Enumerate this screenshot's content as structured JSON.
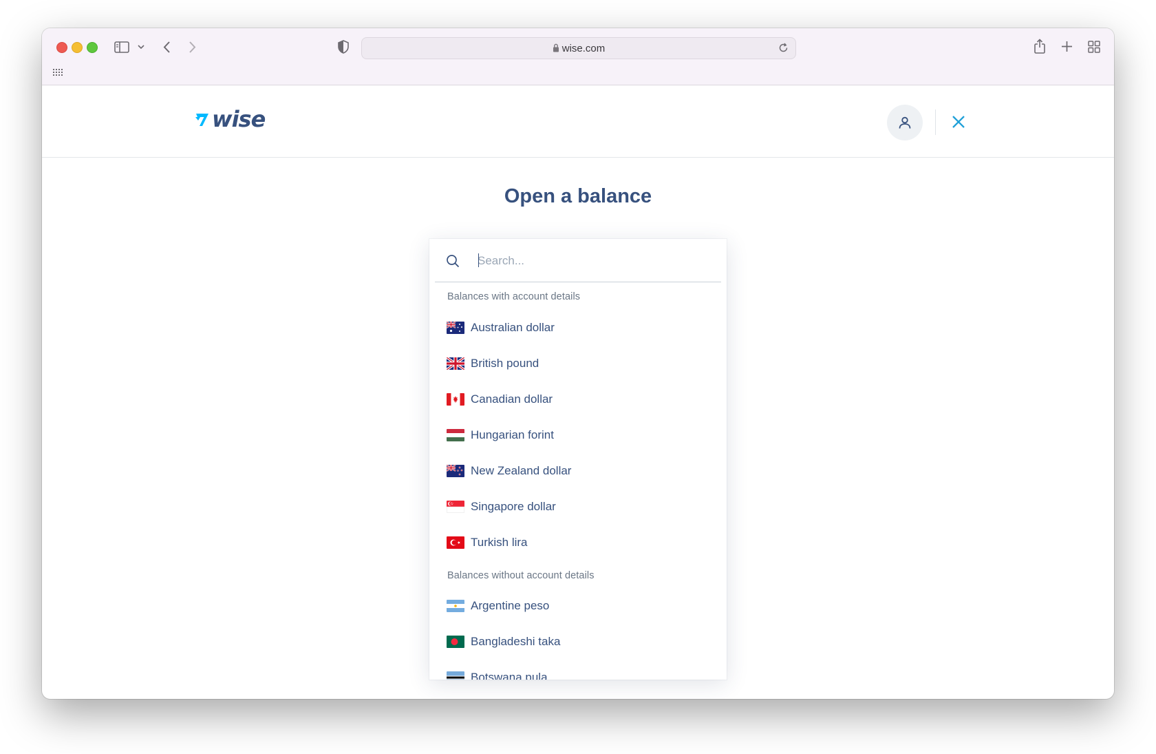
{
  "browser": {
    "url": "wise.com"
  },
  "header": {
    "logo_text": "WISE"
  },
  "page": {
    "title": "Open a balance"
  },
  "search": {
    "placeholder": "Search..."
  },
  "groups": [
    {
      "label": "Balances with account details",
      "items": [
        {
          "label": "Australian dollar",
          "flag": "au-flag"
        },
        {
          "label": "British pound",
          "flag": "gb-flag"
        },
        {
          "label": "Canadian dollar",
          "flag": "ca-flag"
        },
        {
          "label": "Hungarian forint",
          "flag": "hu-flag"
        },
        {
          "label": "New Zealand dollar",
          "flag": "nz-flag"
        },
        {
          "label": "Singapore dollar",
          "flag": "sg-flag"
        },
        {
          "label": "Turkish lira",
          "flag": "tr-flag"
        }
      ]
    },
    {
      "label": "Balances without account details",
      "items": [
        {
          "label": "Argentine peso",
          "flag": "ar-flag"
        },
        {
          "label": "Bangladeshi taka",
          "flag": "bd-flag"
        },
        {
          "label": "Botswana pula",
          "flag": "bw-flag"
        }
      ]
    }
  ],
  "colors": {
    "brand_navy": "#37517e",
    "brand_blue": "#00b9ff",
    "close_teal": "#1fa0d8"
  }
}
